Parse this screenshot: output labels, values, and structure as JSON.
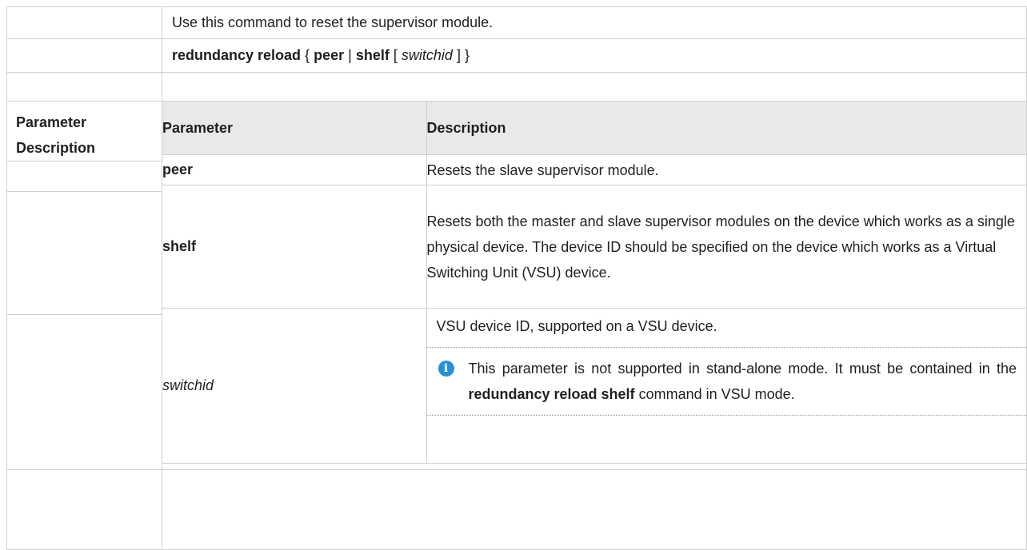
{
  "rows": {
    "description_text": "Use this command to reset the supervisor module.",
    "syntax": {
      "cmd": "redundancy reload",
      "open_brace": "{",
      "peer": "peer",
      "pipe": "|",
      "shelf": "shelf",
      "open_bracket": "[",
      "arg": "switchid",
      "close_bracket": "]",
      "close_brace": "}"
    },
    "param_label_line1": "Parameter",
    "param_label_line2": "Description"
  },
  "param_table": {
    "header_param": "Parameter",
    "header_desc": "Description",
    "items": [
      {
        "name": "peer",
        "desc": "Resets the slave supervisor module."
      },
      {
        "name": "shelf",
        "desc": "Resets both the master and slave supervisor modules on the device which works as a single physical device. The device ID should be specified on the device which works as a Virtual Switching Unit (VSU) device."
      },
      {
        "name": "switchid",
        "desc": "VSU device ID, supported on a VSU device.",
        "note_pre": "This parameter is not supported in stand-alone mode. It must be contained in the ",
        "note_cmd": "redundancy reload shelf",
        "note_post": " command in VSU mode."
      }
    ]
  },
  "icons": {
    "note_icon": "info-icon",
    "note_icon_glyph": "i",
    "note_icon_color": "#2b8fd6"
  }
}
